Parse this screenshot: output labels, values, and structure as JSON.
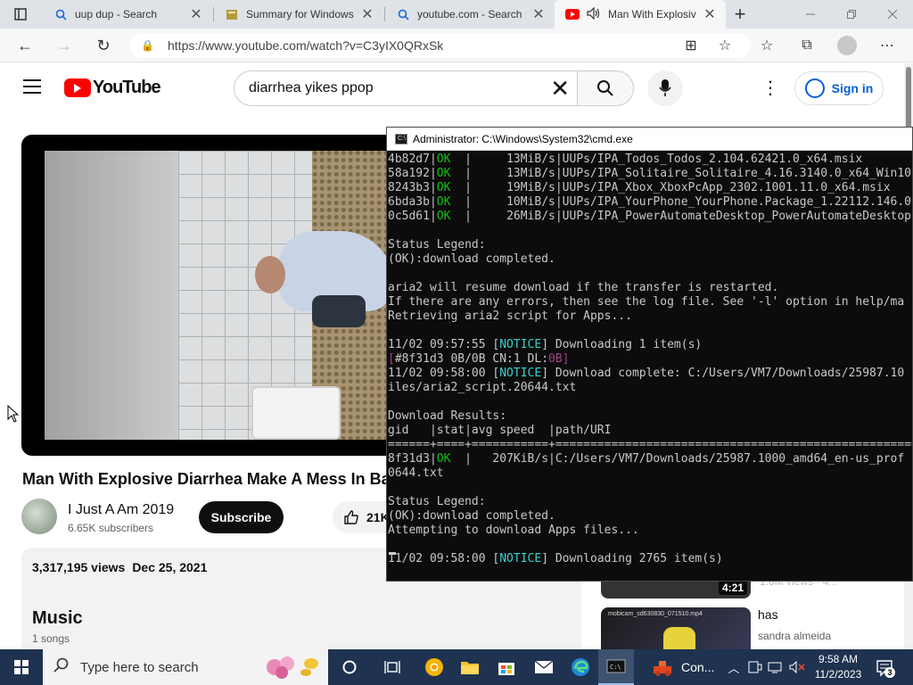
{
  "browser": {
    "tabs": [
      {
        "title": "uup dup - Search",
        "icon": "search-icon"
      },
      {
        "title": "Summary for Windows",
        "icon": "uupdump-icon"
      },
      {
        "title": "youtube.com - Search",
        "icon": "search-icon"
      },
      {
        "title": "Man With Explosiv",
        "icon": "youtube-icon",
        "active": true
      }
    ],
    "new_tab_label": "+",
    "url": "https://www.youtube.com/watch?v=C3yIX0QRxSk"
  },
  "youtube": {
    "logo_text": "YouTube",
    "search_value": "diarrhea yikes ppop",
    "sign_in_label": "Sign in",
    "video_title": "Man With Explosive Diarrhea Make A Mess In Ba",
    "channel": {
      "name": "I Just A Am 2019",
      "subscribers": "6.65K subscribers"
    },
    "subscribe_label": "Subscribe",
    "likes": "21K",
    "views": "3,317,195 views",
    "date": "Dec 25, 2021",
    "music_title": "Music",
    "music_count": "1 songs",
    "recommendations": [
      {
        "duration": "4:21",
        "meta": "1.6M views · 4..."
      },
      {
        "title": "has",
        "channel": "sandra almeida",
        "caption": "mobicam_sd630830_071510.mp4"
      }
    ]
  },
  "cmd": {
    "title": "Administrator: C:\\Windows\\System32\\cmd.exe",
    "lines": [
      {
        "pre": "4b82d7|",
        "ok": "OK",
        "post": "  |     13MiB/s|UUPs/IPA_Todos_Todos_2.104.62421.0_x64.msix"
      },
      {
        "pre": "58a192|",
        "ok": "OK",
        "post": "  |     13MiB/s|UUPs/IPA_Solitaire_Solitaire_4.16.3140.0_x64_Win10"
      },
      {
        "pre": "8243b3|",
        "ok": "OK",
        "post": "  |     19MiB/s|UUPs/IPA_Xbox_XboxPcApp_2302.1001.11.0_x64.msix"
      },
      {
        "pre": "6bda3b|",
        "ok": "OK",
        "post": "  |     10MiB/s|UUPs/IPA_YourPhone_YourPhone.Package_1.22112.146.0"
      },
      {
        "pre": "0c5d61|",
        "ok": "OK",
        "post": "  |     26MiB/s|UUPs/IPA_PowerAutomateDesktop_PowerAutomateDesktop"
      },
      {
        "text": ""
      },
      {
        "text": "Status Legend:"
      },
      {
        "text": "(OK):download completed."
      },
      {
        "text": ""
      },
      {
        "text": "aria2 will resume download if the transfer is restarted."
      },
      {
        "text": "If there are any errors, then see the log file. See '-l' option in help/ma"
      },
      {
        "text": "Retrieving aria2 script for Apps..."
      },
      {
        "text": ""
      },
      {
        "pre": "11/02 09:57:55 [",
        "notice": "NOTICE",
        "post": "] Downloading 1 item(s)"
      },
      {
        "dim_pre": "[",
        "pre": "#8f31d3 0B/0B CN:1 DL:",
        "dim": "0B",
        "dim_post": "]"
      },
      {
        "pre": "11/02 09:58:00 [",
        "notice": "NOTICE",
        "post": "] Download complete: C:/Users/VM7/Downloads/25987.10"
      },
      {
        "text": "iles/aria2_script.20644.txt"
      },
      {
        "text": ""
      },
      {
        "text": "Download Results:"
      },
      {
        "text": "gid   |stat|avg speed  |path/URI"
      },
      {
        "text": "======+====+===========+======================================================="
      },
      {
        "pre": "8f31d3|",
        "ok": "OK",
        "post": "  |   207KiB/s|C:/Users/VM7/Downloads/25987.1000_amd64_en-us_prof"
      },
      {
        "text": "0644.txt"
      },
      {
        "text": ""
      },
      {
        "text": "Status Legend:"
      },
      {
        "text": "(OK):download completed."
      },
      {
        "text": "Attempting to download Apps files..."
      },
      {
        "text": ""
      },
      {
        "pre": "11/02 09:58:00 [",
        "notice": "NOTICE",
        "post": "] Downloading 2765 item(s)"
      }
    ]
  },
  "taskbar": {
    "search_placeholder": "Type here to search",
    "running_app_label": "Con...",
    "time": "9:58 AM",
    "date": "11/2/2023",
    "notifications": "3"
  }
}
